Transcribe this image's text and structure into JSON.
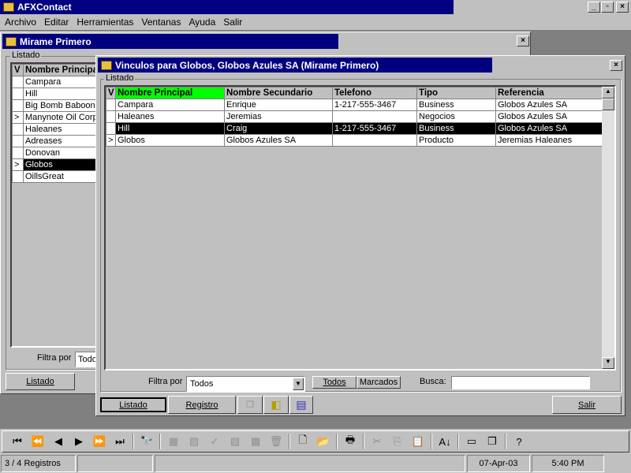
{
  "app": {
    "title": "AFXContact",
    "controls": [
      "_",
      "▫",
      "×"
    ]
  },
  "menu": [
    "Archivo",
    "Editar",
    "Herramientas",
    "Ventanas",
    "Ayuda",
    "Salir"
  ],
  "win1": {
    "title": "Mirame Primero",
    "group": "Listado",
    "col_v": "V",
    "col_name": "Nombre Principal",
    "rows": [
      {
        "m": "",
        "n": "Campara"
      },
      {
        "m": "",
        "n": "Hill"
      },
      {
        "m": "",
        "n": "Big Bomb Baboons"
      },
      {
        "m": ">",
        "n": "Manynote Oil Corp."
      },
      {
        "m": "",
        "n": "Haleanes"
      },
      {
        "m": "",
        "n": "Adreases"
      },
      {
        "m": "",
        "n": "Donovan"
      },
      {
        "m": ">",
        "n": "Globos",
        "selected": true
      },
      {
        "m": "",
        "n": "OillsGreat"
      }
    ],
    "filter_label": "Filtra por",
    "filter_value": "Todos",
    "tab_listado": "Listado"
  },
  "win2": {
    "title": "Vinculos para Globos, Globos Azules SA (Mirame Primero)",
    "group": "Listado",
    "columns": [
      "V",
      "Nombre Principal",
      "Nombre Secundario",
      "Telefono",
      "Tipo",
      "Referencia"
    ],
    "rows": [
      [
        "",
        "Campara",
        "Enrique",
        "1-217-555-3467",
        "Business",
        "Globos Azules SA"
      ],
      [
        "",
        "Haleanes",
        "Jeremias",
        "",
        "Negocios",
        "Globos Azules SA"
      ],
      [
        "",
        "Hill",
        "Craig",
        "1-217-555-3467",
        "Business",
        "Globos Azules SA"
      ],
      [
        ">",
        "Globos",
        "Globos Azules SA",
        "",
        "Producto",
        "Jeremias Haleanes"
      ]
    ],
    "selected_row": 2,
    "header_highlight": "#00ff00",
    "filter_label": "Filtra por",
    "filter_value": "Todos",
    "btn_todos": "Todos",
    "btn_marcados": "Marcados",
    "search_label": "Busca:",
    "search_value": "",
    "tab_listado": "Listado",
    "tab_registro": "Registro",
    "btn_salir": "Salir"
  },
  "toolbar": [
    {
      "icon": "first-icon",
      "g": "⏮"
    },
    {
      "icon": "prev-page-icon",
      "g": "⏪"
    },
    {
      "icon": "prev-icon",
      "g": "◀"
    },
    {
      "icon": "next-icon",
      "g": "▶"
    },
    {
      "icon": "next-page-icon",
      "g": "⏩"
    },
    {
      "icon": "last-icon",
      "g": "⏭"
    },
    {
      "sep": true
    },
    {
      "icon": "binoculars-icon",
      "g": "🔭"
    },
    {
      "sep": true
    },
    {
      "icon": "new-record-icon",
      "g": "▦",
      "d": true
    },
    {
      "icon": "edit-record-icon",
      "g": "▧",
      "d": true
    },
    {
      "icon": "check-icon",
      "g": "✓",
      "d": true
    },
    {
      "icon": "undo-icon",
      "g": "▨",
      "d": true
    },
    {
      "icon": "cancel-icon",
      "g": "▩",
      "d": true
    },
    {
      "icon": "trash-icon",
      "g": "🗑",
      "d": true
    },
    {
      "sep": true
    },
    {
      "icon": "new-file-icon",
      "g": "🗋"
    },
    {
      "icon": "open-folder-icon",
      "g": "📂"
    },
    {
      "sep": true
    },
    {
      "icon": "print-icon",
      "g": "🖶"
    },
    {
      "sep": true
    },
    {
      "icon": "cut-icon",
      "g": "✂",
      "d": true
    },
    {
      "icon": "copy-icon",
      "g": "⎘",
      "d": true
    },
    {
      "icon": "paste-icon",
      "g": "📋",
      "d": true
    },
    {
      "sep": true
    },
    {
      "icon": "sort-icon",
      "g": "A↓"
    },
    {
      "sep": true
    },
    {
      "icon": "tile-icon",
      "g": "▭"
    },
    {
      "icon": "cascade-icon",
      "g": "❐"
    },
    {
      "sep": true
    },
    {
      "icon": "help-icon",
      "g": "?"
    }
  ],
  "status": {
    "records": "3 / 4 Registros",
    "date": "07-Apr-03",
    "time": "5:40 PM"
  }
}
